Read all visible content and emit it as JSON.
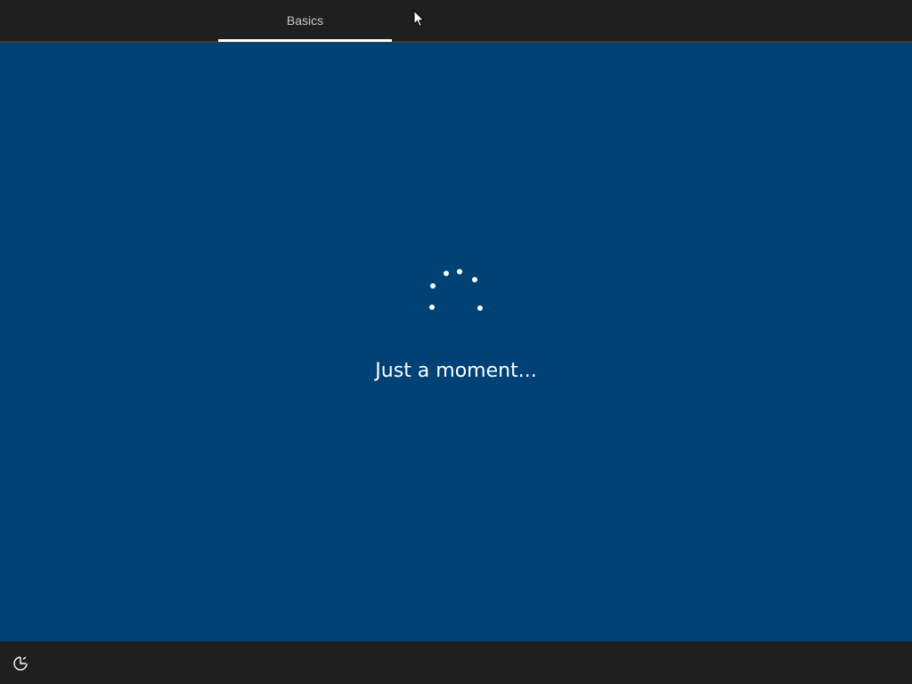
{
  "header": {
    "tabs": [
      {
        "label": "Basics",
        "active": true
      }
    ]
  },
  "main": {
    "status_message": "Just a moment..."
  },
  "footer": {
    "accessibility_icon": "ease-of-access-icon"
  },
  "colors": {
    "background": "#004275",
    "bar": "#1f1f1f",
    "text": "#ffffff",
    "tab_text": "#c8c8c8"
  }
}
